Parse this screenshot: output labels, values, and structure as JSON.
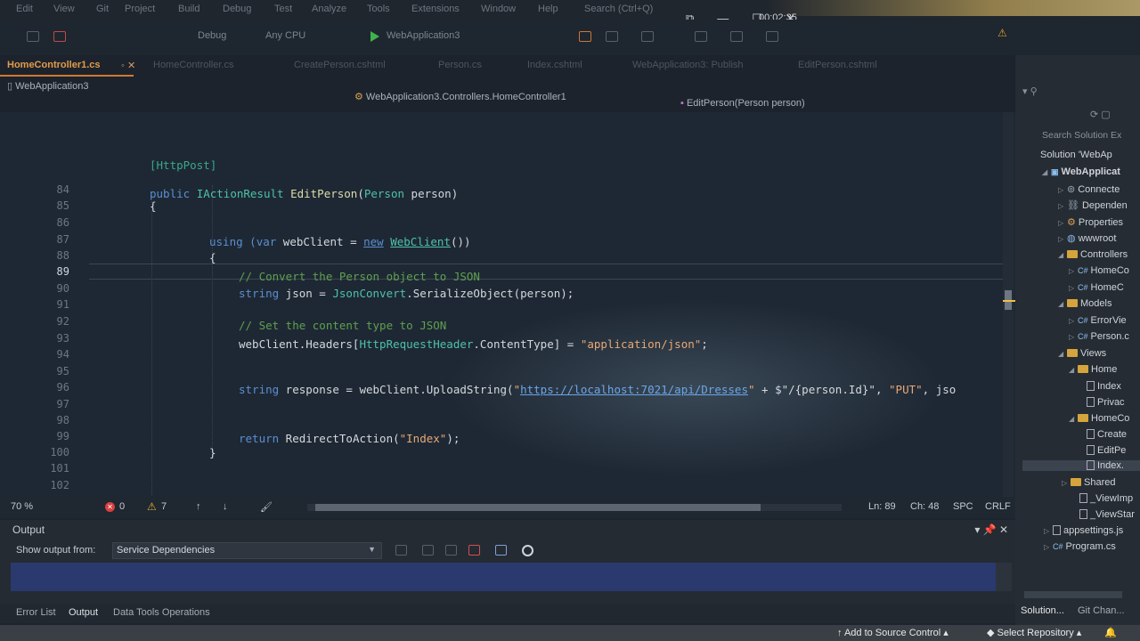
{
  "menu": {
    "items": [
      "Edit",
      "View",
      "Git",
      "Project",
      "Build",
      "Debug",
      "Test",
      "Analyze",
      "Tools",
      "Extensions",
      "Window",
      "Help"
    ],
    "search": "Search (Ctrl+Q)",
    "time": "00:02:35"
  },
  "toolbar": {
    "config": "Debug",
    "platform": "Any CPU",
    "run_target": "WebApplication3"
  },
  "tabs": [
    {
      "label": "HomeController1.cs",
      "active": true
    },
    {
      "label": "HomeController.cs",
      "active": false
    },
    {
      "label": "CreatePerson.cshtml",
      "active": false
    },
    {
      "label": "Person.cs",
      "active": false
    },
    {
      "label": "Index.cshtml",
      "active": false
    },
    {
      "label": "WebApplication3: Publish",
      "active": false
    },
    {
      "label": "EditPerson.cshtml",
      "active": false
    }
  ],
  "nav": {
    "project": "WebApplication3",
    "class": "WebApplication3.Controllers.HomeController1",
    "member": "EditPerson(Person person)"
  },
  "editor": {
    "line_numbers": [
      "84",
      "85",
      "86",
      "87",
      "88",
      "89",
      "90",
      "91",
      "92",
      "93",
      "94",
      "95",
      "96",
      "97",
      "98",
      "99",
      "100",
      "101",
      "102"
    ],
    "current_line": "89",
    "code": {
      "attr": "[HttpPost]",
      "l84_kw": "public",
      "l84_type": "IActionResult",
      "l84_fn": "EditPerson",
      "l84_ptype": "Person",
      "l84_param": " person)",
      "l85": "{",
      "l87_kw": "using",
      "l87_var": "(var",
      "l87_mid": " webClient = ",
      "l87_new": "new",
      "l87_type": "WebClient",
      "l87_end": "())",
      "l88": "{",
      "l89_comment": "// Convert the Person object to JSON",
      "l90_kw": "string",
      "l90_mid": " json = ",
      "l90_type": "JsonConvert",
      "l90_end": ".SerializeObject(person);",
      "l92_comment": "// Set the content type to JSON",
      "l93_a": "webClient.Headers[",
      "l93_type": "HttpRequestHeader",
      "l93_b": ".ContentType] = ",
      "l93_str": "\"application/json\"",
      "l93_end": ";",
      "l96_kw": "string",
      "l96_a": " response = webClient.UploadString(",
      "l96_q1": "\"",
      "l96_url": "https://localhost:7021/api/Dresses",
      "l96_q2": "\"",
      "l96_b": " + $\"/{person.Id}\", ",
      "l96_put": "\"PUT\"",
      "l96_c": ", jso",
      "l99_kw": "return",
      "l99_a": " RedirectToAction(",
      "l99_str": "\"Index\"",
      "l99_end": ");",
      "l100": "}"
    }
  },
  "editor_status": {
    "zoom": "70 %",
    "errors": "0",
    "warnings": "7",
    "line": "Ln: 89",
    "col": "Ch: 48",
    "spacing": "SPC",
    "eol": "CRLF"
  },
  "output": {
    "title": "Output",
    "show_from_label": "Show output from:",
    "source": "Service Dependencies"
  },
  "bottom_tabs": [
    "Error List",
    "Output",
    "Data Tools Operations"
  ],
  "statusbar": {
    "source_control": "Add to Source Control",
    "repo": "Select Repository"
  },
  "solution": {
    "search": "Search Solution Ex",
    "items": [
      {
        "label": "Solution 'WebAp",
        "kind": "solution"
      },
      {
        "label": "WebApplicat",
        "kind": "project"
      },
      {
        "label": "Connecte",
        "kind": "node"
      },
      {
        "label": "Dependen",
        "kind": "node"
      },
      {
        "label": "Properties",
        "kind": "node"
      },
      {
        "label": "wwwroot",
        "kind": "node"
      },
      {
        "label": "Controllers",
        "kind": "folder"
      },
      {
        "label": "HomeCo",
        "kind": "cs"
      },
      {
        "label": "HomeC",
        "kind": "cs"
      },
      {
        "label": "Models",
        "kind": "folder"
      },
      {
        "label": "ErrorVie",
        "kind": "cs"
      },
      {
        "label": "Person.c",
        "kind": "cs"
      },
      {
        "label": "Views",
        "kind": "folder"
      },
      {
        "label": "Home",
        "kind": "folder"
      },
      {
        "label": "Index",
        "kind": "file"
      },
      {
        "label": "Privac",
        "kind": "file"
      },
      {
        "label": "HomeCo",
        "kind": "folder"
      },
      {
        "label": "Create",
        "kind": "file"
      },
      {
        "label": "EditPe",
        "kind": "file"
      },
      {
        "label": "Index.",
        "kind": "file"
      },
      {
        "label": "Shared",
        "kind": "folder"
      },
      {
        "label": "_ViewImp",
        "kind": "file"
      },
      {
        "label": "_ViewStar",
        "kind": "file"
      },
      {
        "label": "appsettings.js",
        "kind": "file"
      },
      {
        "label": "Program.cs",
        "kind": "cs"
      }
    ],
    "tabs": [
      "Solution...",
      "Git Chan..."
    ]
  }
}
